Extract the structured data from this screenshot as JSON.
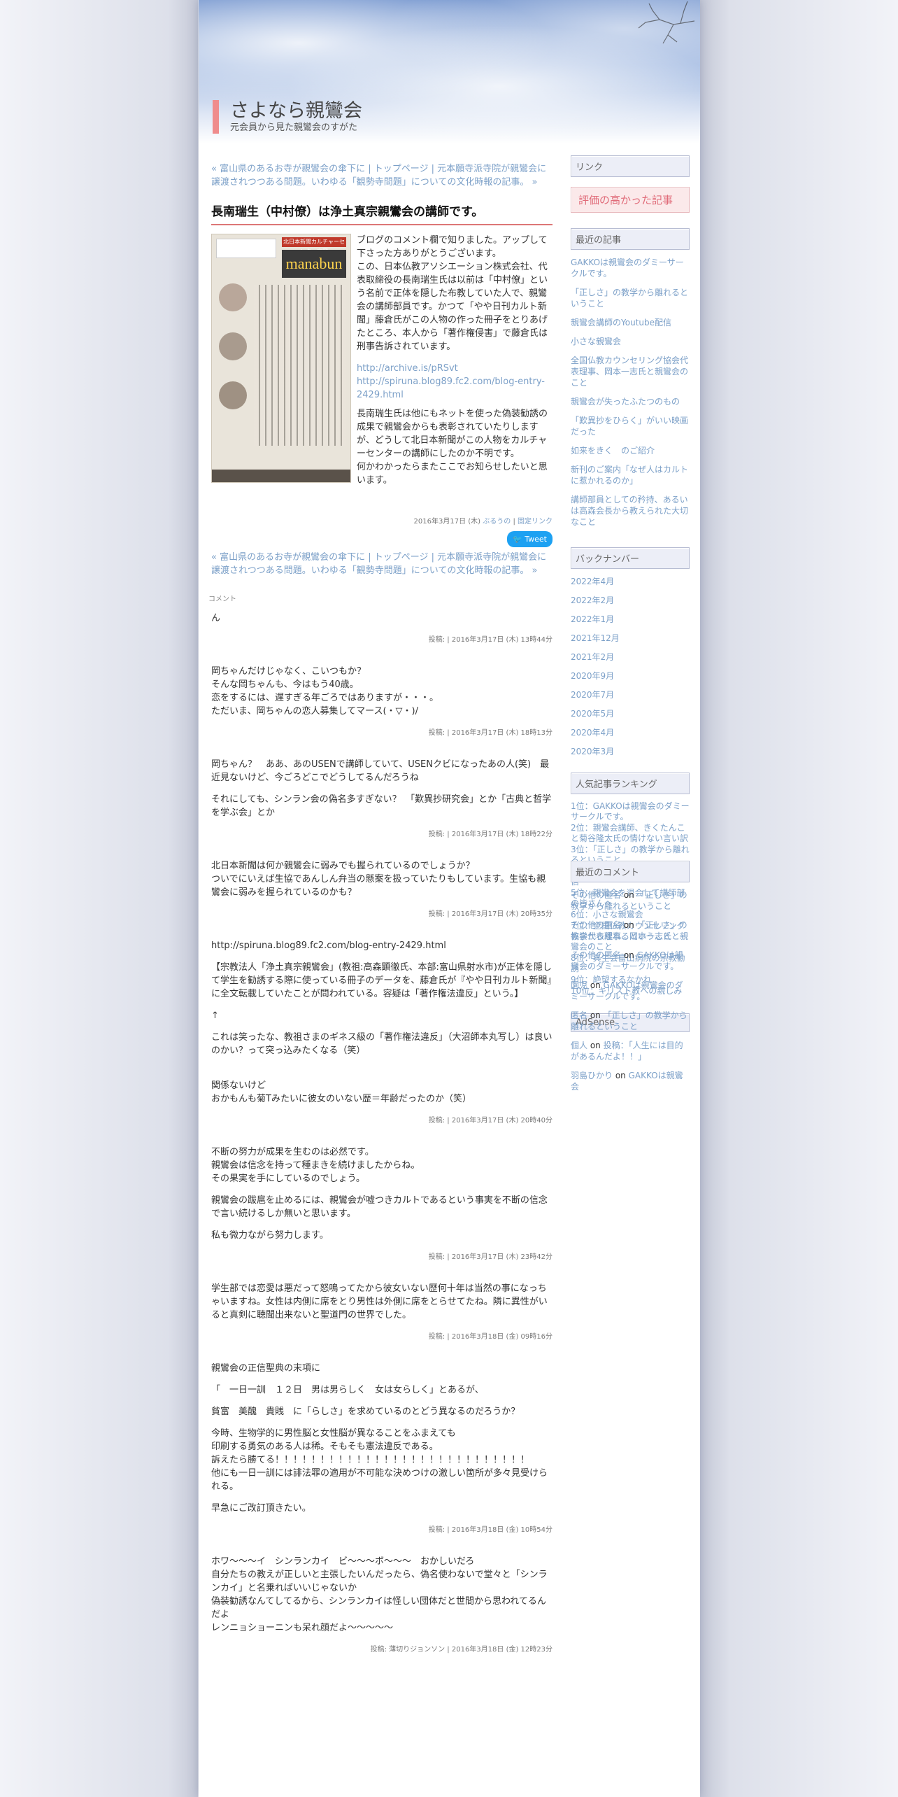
{
  "site": {
    "title": "さよなら親鸞会",
    "description": "元会員から見た親鸞会のすがた"
  },
  "nav": {
    "prev": "« 富山県のあるお寺が親鸞会の傘下に",
    "sep1": " | ",
    "top": "トップページ",
    "sep2": " | ",
    "next": "元本願寺派寺院が親鸞会に譲渡されつつある問題。いわゆる「観勢寺問題」についての文化時報の記事。 »"
  },
  "entry": {
    "title": "長南瑞生（中村僚）は浄土真宗親鸞会の講師です。",
    "image_text": {
      "banner": "manabun",
      "tag": "北日本新聞カルチャーセンター高岡"
    },
    "para1": "ブログのコメント欄で知りました。アップして下さった方ありがとうございます。\nこの、日本仏教アソシエーション株式会社、代表取締役の長南瑞生氏は以前は「中村僚」という名前で正体を隠した布教していた人で、親鸞会の講師部員です。かつて「やや日刊カルト新聞」藤倉氏がこの人物の作った冊子をとりあげたところ、本人から「著作権侵害」で藤倉氏は刑事告訴されています。",
    "link1": "http://archive.is/pRSvt",
    "link2": "http://spiruna.blog89.fc2.com/blog-entry-2429.html",
    "para2": "長南瑞生氏は他にもネットを使った偽装勧誘の成果で親鸞会からも表彰されていたりしますが、どうして北日本新聞がこの人物をカルチャーセンターの講師にしたのか不明です。\n何かわかったらまたここでお知らせしたいと思います。",
    "footer_date": "2016年3月17日 (木)",
    "footer_cat": "ぶるうの",
    "footer_sep": " | ",
    "footer_permalink": "固定リンク",
    "tweet": "Tweet"
  },
  "comment_label": "コメント",
  "comments": [
    {
      "paras": [
        "ん"
      ],
      "meta": "投稿: | 2016年3月17日 (木) 13時44分"
    },
    {
      "paras": [
        "岡ちゃんだけじゃなく、こいつもか？\nそんな岡ちゃんも、今はもう40歳。\n恋をするには、遅すぎる年ごろではありますが・・・。\nただいま、岡ちゃんの恋人募集してマース(・▽・)/"
      ],
      "meta": "投稿: | 2016年3月17日 (木) 18時13分"
    },
    {
      "paras": [
        "岡ちゃん？　ああ、あのUSENで講師していて、USENクビになったあの人(笑)　最近見ないけど、今ごろどこでどうしてるんだろうね",
        "それにしても、シンラン会の偽名多すぎない？　「歎異抄研究会」とか「古典と哲学を学ぶ会」とか"
      ],
      "meta": "投稿: | 2016年3月17日 (木) 18時22分"
    },
    {
      "paras": [
        "北日本新聞は何か親鸞会に弱みでも握られているのでしょうか？\nついでにいえば生協であんしん弁当の懸案を扱っていたりもしています。生協も親鸞会に弱みを握られているのかも？"
      ],
      "meta": "投稿: | 2016年3月17日 (木) 20時35分"
    },
    {
      "paras": [
        "http://spiruna.blog89.fc2.com/blog-entry-2429.html",
        "【宗教法人「浄土真宗親鸞会」(教祖:高森顕徹氏、本部:富山県射水市)が正体を隠して学生を勧誘する際に使っている冊子のデータを、藤倉氏が『やや日刊カルト新聞』に全文転載していたことが問われている。容疑は「著作権法違反」という。】",
        "↑",
        "これは笑ったな、教祖さまのギネス級の「著作権法違反」（大沼師本丸写し）は良いのかい？って突っ込みたくなる（笑）",
        "\n関係ないけど\nおかもんも菊Tみたいに彼女のいない歴＝年齢だったのか（笑）"
      ],
      "meta": "投稿: | 2016年3月17日 (木) 20時40分"
    },
    {
      "paras": [
        "不断の努力が成果を生むのは必然です。\n親鸞会は信念を持って種まきを続けましたからね。\nその果実を手にしているのでしょう。",
        "親鸞会の跋扈を止めるには、親鸞会が嘘つきカルトであるという事実を不断の信念で言い続けるしか無いと思います。",
        "私も微力ながら努力します。"
      ],
      "meta": "投稿: | 2016年3月17日 (木) 23時42分"
    },
    {
      "paras": [
        "学生部では恋愛は悪だって怒鳴ってたから彼女いない歴何十年は当然の事になっちゃいますね。女性は内側に席をとり男性は外側に席をとらせてたね。隣に異性がいると真剣に聴聞出来ないと聖道門の世界でした。"
      ],
      "meta": "投稿: | 2016年3月18日 (金) 09時16分"
    },
    {
      "paras": [
        "親鸞会の正信聖典の末項に",
        "「　一日一訓　１２日　男は男らしく　女は女らしく」とあるが、",
        "貧富　美醜　貴賎　に「らしさ」を求めているのとどう異なるのだろうか？",
        "今時、生物学的に男性脳と女性脳が異なることをふまえても\n印刷する勇気のある人は稀。そもそも憲法違反である。\n訴えたら勝てる！！！！！！！！！！！！！！！！！！！！！！！！！！！！\n他にも一日一訓には誹法罪の適用が不可能な決めつけの激しい箇所が多々見受けられる。",
        "早急にご改訂頂きたい。"
      ],
      "meta": "投稿: | 2016年3月18日 (金) 10時54分"
    },
    {
      "paras": [
        "ホワ～～～イ　シンランカイ　ビ～～～ボ～～～　おかしいだろ\n自分たちの教えが正しいと主張したいんだったら、偽名使わないで堂々と「シンランカイ」と名乗ればいいじゃないか\n偽装勧誘なんてしてるから、シンランカイは怪しい団体だと世間から思われてるんだよ\nレンニョショーニンも呆れ顔だよ～～～～～"
      ],
      "meta": "投稿: 薄切りジョンソン | 2016年3月18日 (金) 12時23分"
    }
  ],
  "sidebar": {
    "links_head": "リンク",
    "pink_head": "評価の高かった記事",
    "recent_head": "最近の記事",
    "recent": [
      "GAKKOは親鸞会のダミーサークルです。",
      "「正しさ」の教学から離れるということ",
      "親鸞会講師のYoutube配信",
      "小さな親鸞会",
      "全国仏教カウンセリング協会代表理事、岡本一志氏と親鸞会のこと",
      "親鸞会が失ったふたつのもの",
      "「歎異抄をひらく」がいい映画だった",
      "如来をきく　のご紹介",
      "新刊のご案内「なぜ人はカルトに惹かれるのか」",
      "講師部員としての矜持、あるいは高森会長から教えられた大切なこと"
    ],
    "backnum_head": "バックナンバー",
    "backnum": [
      "2022年4月",
      "2022年2月",
      "2022年1月",
      "2021年12月",
      "2021年2月",
      "2020年9月",
      "2020年7月",
      "2020年5月",
      "2020年4月",
      "2020年3月"
    ],
    "ranking_head": "人気記事ランキング",
    "ranking": [
      {
        "rank": "1位：",
        "title": "GAKKOは親鸞会のダミーサークルです。"
      },
      {
        "rank": "2位：",
        "title": "親鸞会講師、きくたんこと菊谷隆太氏の情けない言い訳"
      },
      {
        "rank": "3位：",
        "title": "「正しさ」の教学から離れるということ"
      },
      {
        "rank": "4位：",
        "title": "親鸞会講師のYoutube配信"
      },
      {
        "rank": "5位：",
        "title": "親鸞会を退会して講師部の皆さんへ"
      },
      {
        "rank": "6位：",
        "title": "小さな親鸞会"
      },
      {
        "rank": "7位：",
        "title": "全国仏教カウンセリング協会代表理事、岡本一志氏と親鸞会のこと"
      },
      {
        "rank": "8位：",
        "title": "真生会富山病院の宗教勧誘"
      },
      {
        "rank": "9位：",
        "title": "絶望するなかれ"
      },
      {
        "rank": "10位：",
        "title": "キリスト教への親しみ"
      }
    ],
    "adsense_head": "AdSense",
    "rc_head": "最近のコメント",
    "recent_comments": [
      {
        "who": "その他の匿名",
        "on": " on ",
        "what": "「正しさ」の教学から離れるということ"
      },
      {
        "who": "その他の匿名",
        "on": " on ",
        "what": "「正しさ」の教学から離れるということ"
      },
      {
        "who": "その他の匿名",
        "on": " on ",
        "what": "GAKKOは親鸞会のダミーサークルです。"
      },
      {
        "who": "園児",
        "on": " on ",
        "what": "GAKKOは親鸞会のダミーサークルです。"
      },
      {
        "who": "匿名",
        "on": " on ",
        "what": "「正しさ」の教学から離れるということ"
      },
      {
        "who": "個人",
        "on": " on ",
        "what": "投稿：「人生には目的があるんだよ！！」"
      },
      {
        "who": "羽島ひかり",
        "on": " on ",
        "what": "GAKKOは親鸞会"
      }
    ]
  }
}
